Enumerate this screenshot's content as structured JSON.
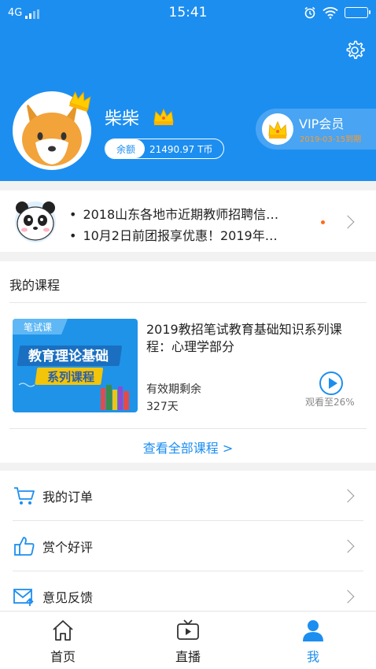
{
  "status_bar": {
    "network": "4G",
    "time": "15:41"
  },
  "profile": {
    "username": "柴柴",
    "balance_label": "余额",
    "balance_value": "21490.97 T币",
    "vip_title": "VIP会员",
    "vip_expire": "2019-03-15到期"
  },
  "news": {
    "items": [
      "2018山东各地市近期教师招聘信…",
      "10月2日前团报享优惠！2019年…"
    ]
  },
  "courses": {
    "section_title": "我的课程",
    "cover_tag": "笔试课",
    "cover_line1": "教育理论基础",
    "cover_line2": "系列课程",
    "title": "2019教招笔试教育基础知识系列课程：心理学部分",
    "remain_label": "有效期剩余",
    "remain_value": "327天",
    "progress_text": "观看至26%",
    "progress_percent": 26,
    "view_all": "查看全部课程 >"
  },
  "menu": {
    "items": [
      {
        "label": "我的订单",
        "icon": "cart-icon"
      },
      {
        "label": "赏个好评",
        "icon": "thumbs-up-icon"
      },
      {
        "label": "意见反馈",
        "icon": "mail-feedback-icon"
      }
    ]
  },
  "tabs": [
    {
      "label": "首页",
      "icon": "home-icon"
    },
    {
      "label": "直播",
      "icon": "tv-icon"
    },
    {
      "label": "我",
      "icon": "user-icon"
    }
  ],
  "colors": {
    "primary": "#1c8ef0",
    "vip_expire": "#ff9a2a",
    "badge_dot": "#ff6a1a"
  }
}
